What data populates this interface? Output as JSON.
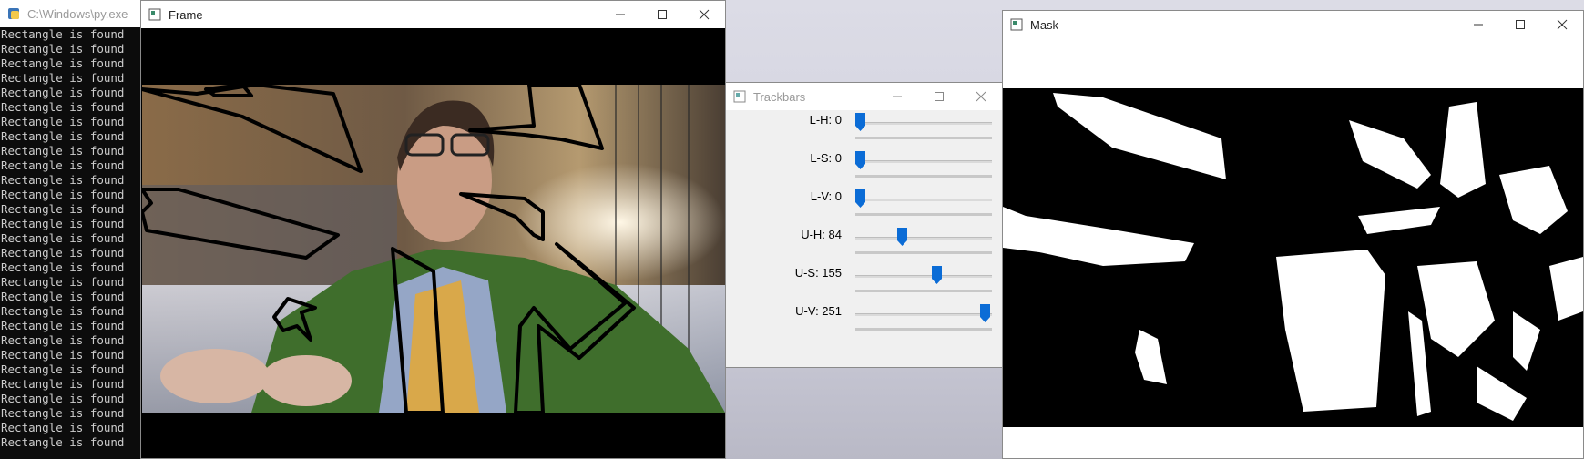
{
  "console": {
    "title": "C:\\Windows\\py.exe",
    "lines": [
      "Rectangle is found",
      "Rectangle is found",
      "Rectangle is found",
      "Rectangle is found",
      "Rectangle is found",
      "Rectangle is found",
      "Rectangle is found",
      "Rectangle is found",
      "Rectangle is found",
      "Rectangle is found",
      "Rectangle is found",
      "Rectangle is found",
      "Rectangle is found",
      "Rectangle is found",
      "Rectangle is found",
      "Rectangle is found",
      "Rectangle is found",
      "Rectangle is found",
      "Rectangle is found",
      "Rectangle is found",
      "Rectangle is found",
      "Rectangle is found",
      "Rectangle is found",
      "Rectangle is found",
      "Rectangle is found",
      "Rectangle is found",
      "Rectangle is found",
      "Rectangle is found",
      "Rectangle is found"
    ]
  },
  "frame": {
    "title": "Frame"
  },
  "trackbars": {
    "title": "Trackbars",
    "max": 255,
    "accent": "#0b6cd6",
    "sliders": [
      {
        "label": "L-H: 0",
        "value": 0
      },
      {
        "label": "L-S: 0",
        "value": 0
      },
      {
        "label": "L-V: 0",
        "value": 0
      },
      {
        "label": "U-H: 84",
        "value": 84
      },
      {
        "label": "U-S: 155",
        "value": 155
      },
      {
        "label": "U-V: 251",
        "value": 251
      }
    ]
  },
  "mask": {
    "title": "Mask"
  },
  "icons": {
    "minimize": "minimize-icon",
    "maximize": "maximize-icon",
    "close": "close-icon",
    "app": "opencv-window-icon"
  }
}
